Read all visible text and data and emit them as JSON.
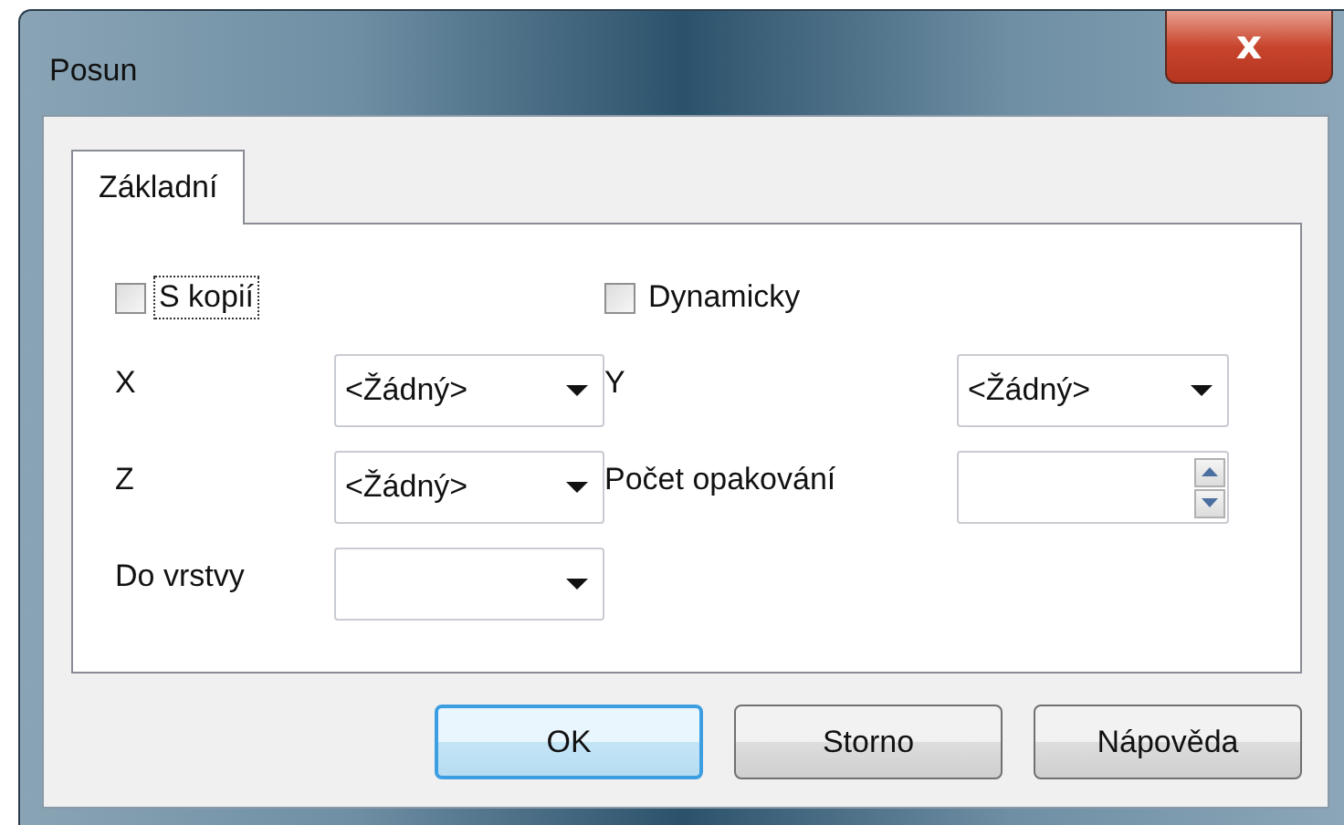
{
  "window": {
    "title": "Posun",
    "close_label": "x"
  },
  "tabs": [
    {
      "label": "Základní",
      "selected": true
    }
  ],
  "checkboxes": [
    {
      "label": "S kopií",
      "checked": false,
      "focused": true
    },
    {
      "label": "Dynamicky",
      "checked": false,
      "focused": false
    }
  ],
  "fields": [
    {
      "label": "X",
      "kind": "combo",
      "value": "<Žádný>"
    },
    {
      "label": "Y",
      "kind": "combo",
      "value": "<Žádný>"
    },
    {
      "label": "Z",
      "kind": "combo",
      "value": "<Žádný>"
    },
    {
      "label": "Počet opakování",
      "kind": "spinner"
    },
    {
      "label": "Do vrstvy",
      "kind": "combo"
    }
  ],
  "buttons": [
    {
      "label": "OK",
      "default": true
    },
    {
      "label": "Storno",
      "default": false
    },
    {
      "label": "Nápověda",
      "default": false
    }
  ]
}
